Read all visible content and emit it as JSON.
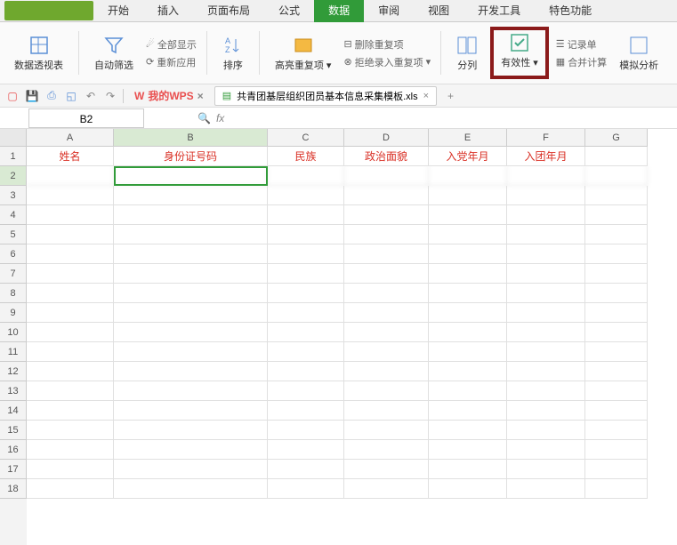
{
  "tabs": {
    "t0": "开始",
    "t1": "插入",
    "t2": "页面布局",
    "t3": "公式",
    "t4": "数据",
    "t5": "审阅",
    "t6": "视图",
    "t7": "开发工具",
    "t8": "特色功能"
  },
  "ribbon": {
    "pivot": "数据透视表",
    "autofilter": "自动筛选",
    "showall": "全部显示",
    "reapply": "重新应用",
    "sort": "排序",
    "highlight": "高亮重复项",
    "removeDup": "删除重复项",
    "rejectDup": "拒绝录入重复项",
    "textToCol": "分列",
    "validity": "有效性",
    "form": "记录单",
    "consolidate": "合并计算",
    "whatIf": "模拟分析"
  },
  "wpsBtn": "我的WPS",
  "docTab": "共青团基层组织团员基本信息采集模板.xls",
  "nameBox": "B2",
  "columns": [
    "A",
    "B",
    "C",
    "D",
    "E",
    "F",
    "G"
  ],
  "headers": {
    "A": "姓名",
    "B": "身份证号码",
    "C": "民族",
    "D": "政治面貌",
    "E": "入党年月",
    "F": "入团年月",
    "G": ""
  },
  "rowCount": 18
}
